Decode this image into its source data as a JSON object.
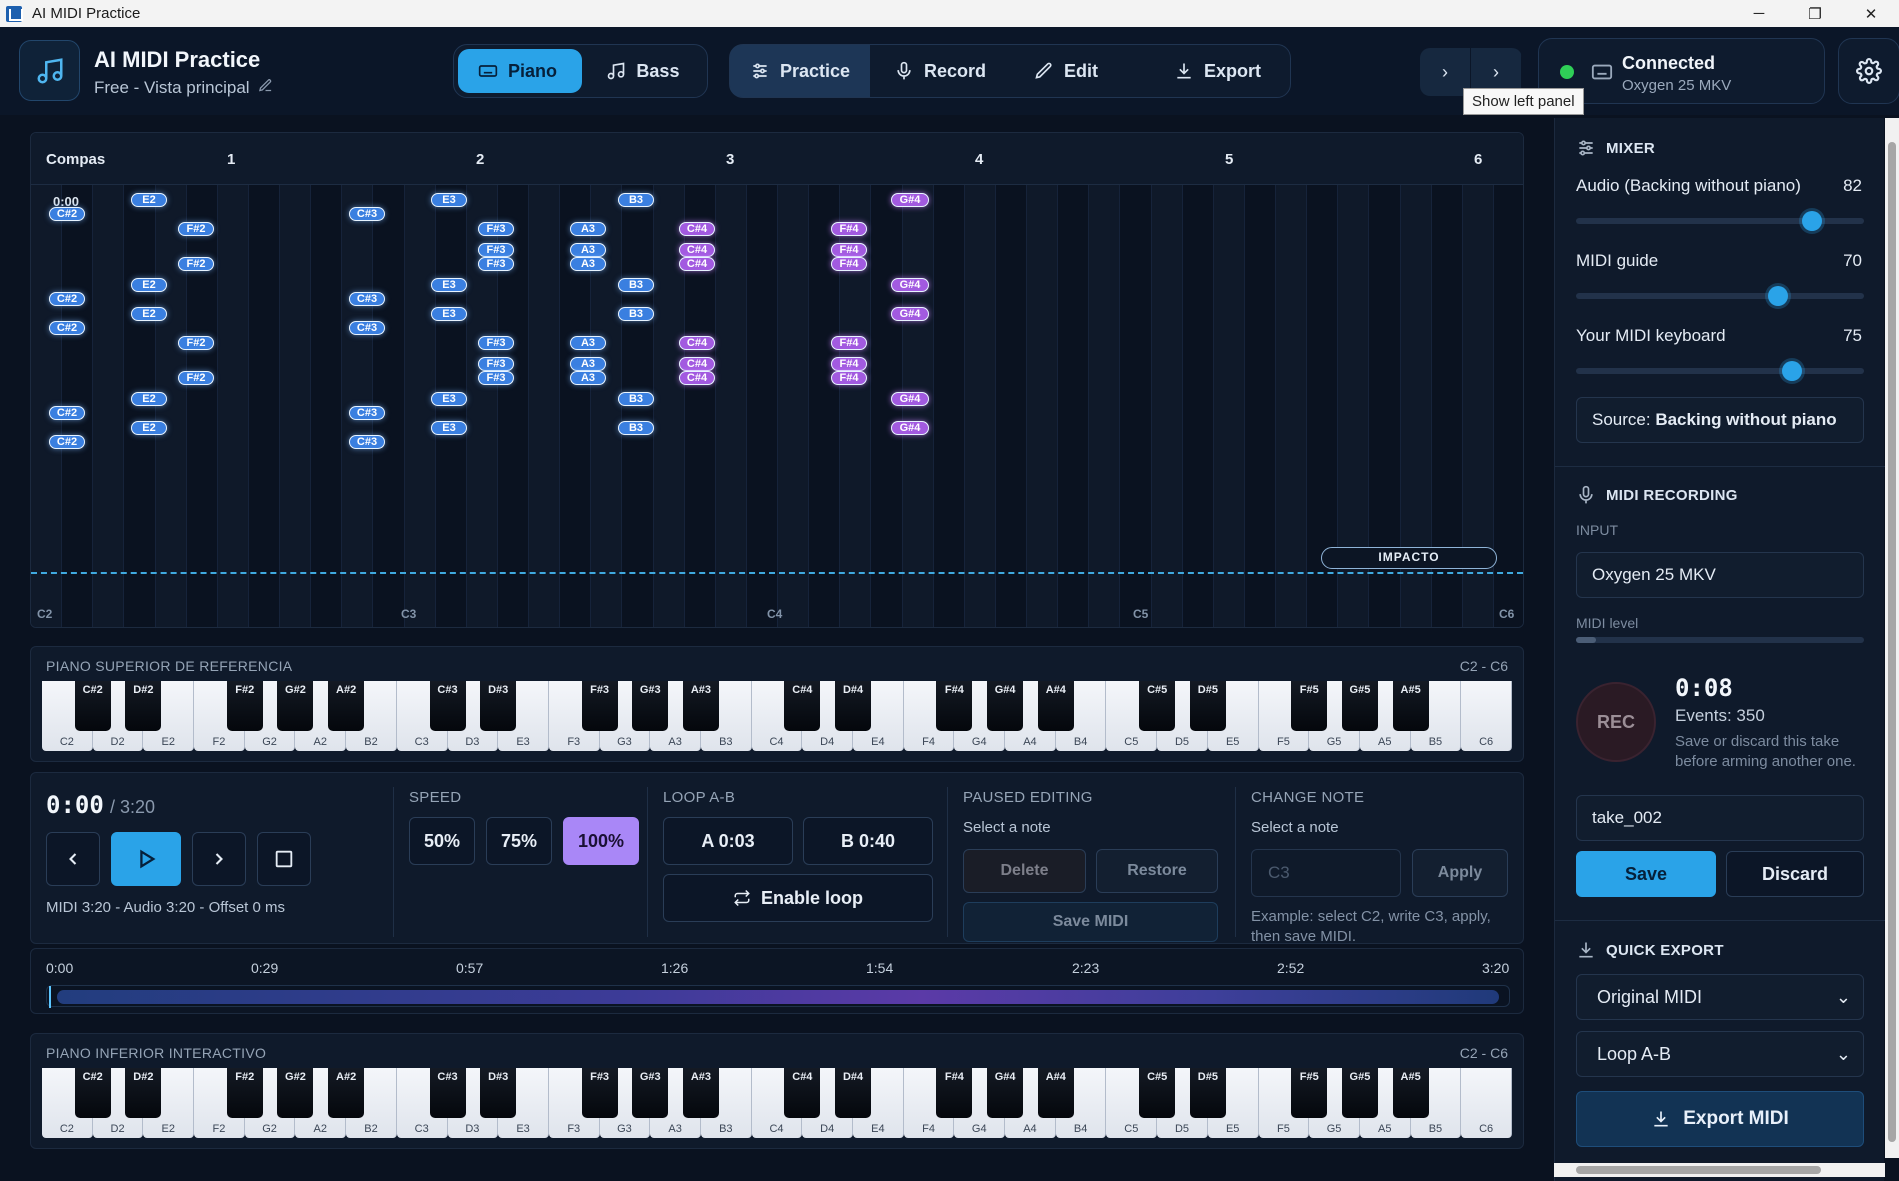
{
  "window": {
    "title": "AI MIDI Practice",
    "controls": [
      "─",
      "❐",
      "✕"
    ]
  },
  "header": {
    "app_title": "AI MIDI Practice",
    "subtitle": "Free - Vista principal",
    "instruments": [
      {
        "label": "Piano",
        "icon": "keyboard-icon",
        "active": true
      },
      {
        "label": "Bass",
        "icon": "music-note-icon",
        "active": false
      }
    ],
    "modes": [
      {
        "label": "Practice",
        "icon": "sliders-icon",
        "active": true
      },
      {
        "label": "Record",
        "icon": "mic-icon",
        "active": false
      },
      {
        "label": "Edit",
        "icon": "pencil-icon",
        "active": false
      },
      {
        "label": "Export",
        "icon": "download-icon",
        "active": false
      }
    ],
    "tooltip": "Show left panel",
    "connection": {
      "status": "Connected",
      "device": "Oxygen 25 MKV",
      "color": "#2fcf57"
    }
  },
  "roll": {
    "compas_label": "Compas",
    "bars": [
      "1",
      "2",
      "3",
      "4",
      "5",
      "6"
    ],
    "start_time": "0:00",
    "marker": "IMPACTO",
    "octaves": [
      "C2",
      "C3",
      "C4",
      "C5",
      "C6"
    ],
    "notes": [
      "C#2",
      "E2",
      "F#2",
      "C#3",
      "E3",
      "F#3",
      "A3",
      "B3",
      "C#4",
      "F#4",
      "G#4"
    ]
  },
  "upper_piano": {
    "title": "PIANO SUPERIOR DE REFERENCIA",
    "range": "C2 - C6"
  },
  "lower_piano": {
    "title": "PIANO INFERIOR INTERACTIVO",
    "range": "C2 - C6"
  },
  "keys": {
    "white": [
      "C2",
      "D2",
      "E2",
      "F2",
      "G2",
      "A2",
      "B2",
      "C3",
      "D3",
      "E3",
      "F3",
      "G3",
      "A3",
      "B3",
      "C4",
      "D4",
      "E4",
      "F4",
      "G4",
      "A4",
      "B4",
      "C5",
      "D5",
      "E5",
      "F5",
      "G5",
      "A5",
      "B5",
      "C6"
    ],
    "black": [
      "C#2",
      "D#2",
      "F#2",
      "G#2",
      "A#2",
      "C#3",
      "D#3",
      "F#3",
      "G#3",
      "A#3",
      "C#4",
      "D#4",
      "F#4",
      "G#4",
      "A#4",
      "C#5",
      "D#5",
      "F#5",
      "G#5",
      "A#5"
    ]
  },
  "transport": {
    "current_time": "0:00",
    "total_time": "/ 3:20",
    "info": "MIDI 3:20 - Audio 3:20 - Offset 0 ms",
    "speed": {
      "title": "SPEED",
      "options": [
        "50%",
        "75%",
        "100%"
      ],
      "selected": "100%",
      "accent": "#a987f7"
    },
    "loop": {
      "title": "LOOP A-B",
      "a": "A 0:03",
      "b": "B 0:40",
      "enable": "Enable loop"
    },
    "paused_editing": {
      "title": "PAUSED EDITING",
      "sub": "Select a note",
      "delete": "Delete",
      "restore": "Restore",
      "save_midi": "Save MIDI"
    },
    "change_note": {
      "title": "CHANGE NOTE",
      "sub": "Select a note",
      "placeholder": "C3",
      "apply": "Apply",
      "help": "Example: select C2, write C3, apply, then save MIDI."
    }
  },
  "timeline": {
    "ticks": [
      "0:00",
      "0:29",
      "0:57",
      "1:26",
      "1:54",
      "2:23",
      "2:52",
      "3:20"
    ],
    "position": 0.0
  },
  "mixer": {
    "title": "MIXER",
    "sliders": [
      {
        "label": "Audio (Backing without piano)",
        "value": 82
      },
      {
        "label": "MIDI guide",
        "value": 70
      },
      {
        "label": "Your MIDI keyboard",
        "value": 75
      }
    ],
    "source_label": "Source:",
    "source_value": "Backing without piano"
  },
  "recording": {
    "title": "MIDI RECORDING",
    "input_label": "INPUT",
    "input_value": "Oxygen 25 MKV",
    "level_label": "MIDI level",
    "level": 0.07,
    "rec": "REC",
    "time": "0:08",
    "events": "Events: 350",
    "hint": "Save or discard this take before arming another one.",
    "take_name": "take_002",
    "save": "Save",
    "discard": "Discard"
  },
  "quick_export": {
    "title": "QUICK EXPORT",
    "format": "Original MIDI",
    "range": "Loop A-B",
    "button": "Export MIDI"
  }
}
